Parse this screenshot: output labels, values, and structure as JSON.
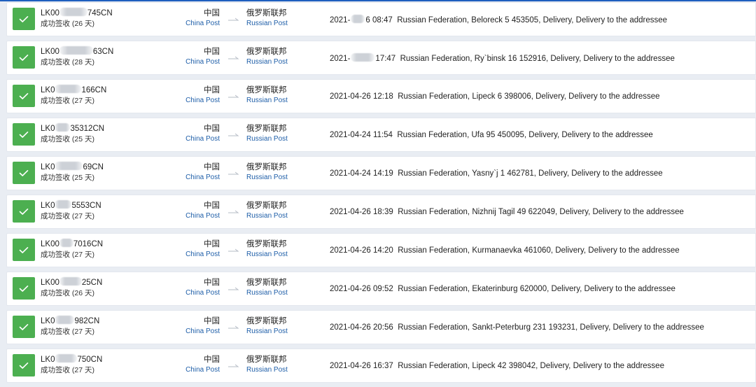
{
  "theme": {
    "accent": "#1f5fbf",
    "check_bg": "#4caf50",
    "carrier_link": "#1e5ea8"
  },
  "rows": [
    {
      "tracking_start": "LK00",
      "tracking_end": "745CN",
      "status": "成功签收 (26 天)",
      "origin_country": "中国",
      "origin_carrier": "China Post",
      "dest_country": "俄罗斯联邦",
      "dest_carrier": "Russian Post",
      "date_start": "2021-",
      "time": "6 08:47",
      "event": "Russian Federation, Beloreck 5 453505, Delivery, Delivery to the addressee"
    },
    {
      "tracking_start": "LK00",
      "tracking_end": "63CN",
      "status": "成功签收 (28 天)",
      "origin_country": "中国",
      "origin_carrier": "China Post",
      "dest_country": "俄罗斯联邦",
      "dest_carrier": "Russian Post",
      "date_start": "2021-",
      "time": "17:47",
      "event": "Russian Federation, Ry`binsk 16 152916, Delivery, Delivery to the addressee"
    },
    {
      "tracking_start": "LK0",
      "tracking_end": "166CN",
      "status": "成功签收 (27 天)",
      "origin_country": "中国",
      "origin_carrier": "China Post",
      "dest_country": "俄罗斯联邦",
      "dest_carrier": "Russian Post",
      "date_start": "",
      "time": "2021-04-26 12:18",
      "event": "Russian Federation, Lipeck 6 398006, Delivery, Delivery to the addressee"
    },
    {
      "tracking_start": "LK0",
      "tracking_end": "35312CN",
      "status": "成功签收 (25 天)",
      "origin_country": "中国",
      "origin_carrier": "China Post",
      "dest_country": "俄罗斯联邦",
      "dest_carrier": "Russian Post",
      "date_start": "",
      "time": "2021-04-24 11:54",
      "event": "Russian Federation, Ufa 95 450095, Delivery, Delivery to the addressee"
    },
    {
      "tracking_start": "LK0",
      "tracking_end": "69CN",
      "status": "成功签收 (25 天)",
      "origin_country": "中国",
      "origin_carrier": "China Post",
      "dest_country": "俄罗斯联邦",
      "dest_carrier": "Russian Post",
      "date_start": "",
      "time": "2021-04-24 14:19",
      "event": "Russian Federation, Yasny`j 1 462781, Delivery, Delivery to the addressee"
    },
    {
      "tracking_start": "LK0",
      "tracking_end": "5553CN",
      "status": "成功签收 (27 天)",
      "origin_country": "中国",
      "origin_carrier": "China Post",
      "dest_country": "俄罗斯联邦",
      "dest_carrier": "Russian Post",
      "date_start": "",
      "time": "2021-04-26 18:39",
      "event": "Russian Federation, Nizhnij Tagil 49 622049, Delivery, Delivery to the addressee"
    },
    {
      "tracking_start": "LK00",
      "tracking_end": "7016CN",
      "status": "成功签收 (27 天)",
      "origin_country": "中国",
      "origin_carrier": "China Post",
      "dest_country": "俄罗斯联邦",
      "dest_carrier": "Russian Post",
      "date_start": "",
      "time": "2021-04-26 14:20",
      "event": "Russian Federation, Kurmanaevka 461060, Delivery, Delivery to the addressee"
    },
    {
      "tracking_start": "LK00",
      "tracking_end": "25CN",
      "status": "成功签收 (26 天)",
      "origin_country": "中国",
      "origin_carrier": "China Post",
      "dest_country": "俄罗斯联邦",
      "dest_carrier": "Russian Post",
      "date_start": "",
      "time": "2021-04-26 09:52",
      "event": "Russian Federation, Ekaterinburg 620000, Delivery, Delivery to the addressee"
    },
    {
      "tracking_start": "LK0",
      "tracking_end": "982CN",
      "status": "成功签收 (27 天)",
      "origin_country": "中国",
      "origin_carrier": "China Post",
      "dest_country": "俄罗斯联邦",
      "dest_carrier": "Russian Post",
      "date_start": "",
      "time": "2021-04-26 20:56",
      "event": "Russian Federation, Sankt-Peterburg 231 193231, Delivery, Delivery to the addressee"
    },
    {
      "tracking_start": "LK0",
      "tracking_end": "750CN",
      "status": "成功签收 (27 天)",
      "origin_country": "中国",
      "origin_carrier": "China Post",
      "dest_country": "俄罗斯联邦",
      "dest_carrier": "Russian Post",
      "date_start": "",
      "time": "2021-04-26 16:37",
      "event": "Russian Federation, Lipeck 42 398042, Delivery, Delivery to the addressee"
    }
  ]
}
